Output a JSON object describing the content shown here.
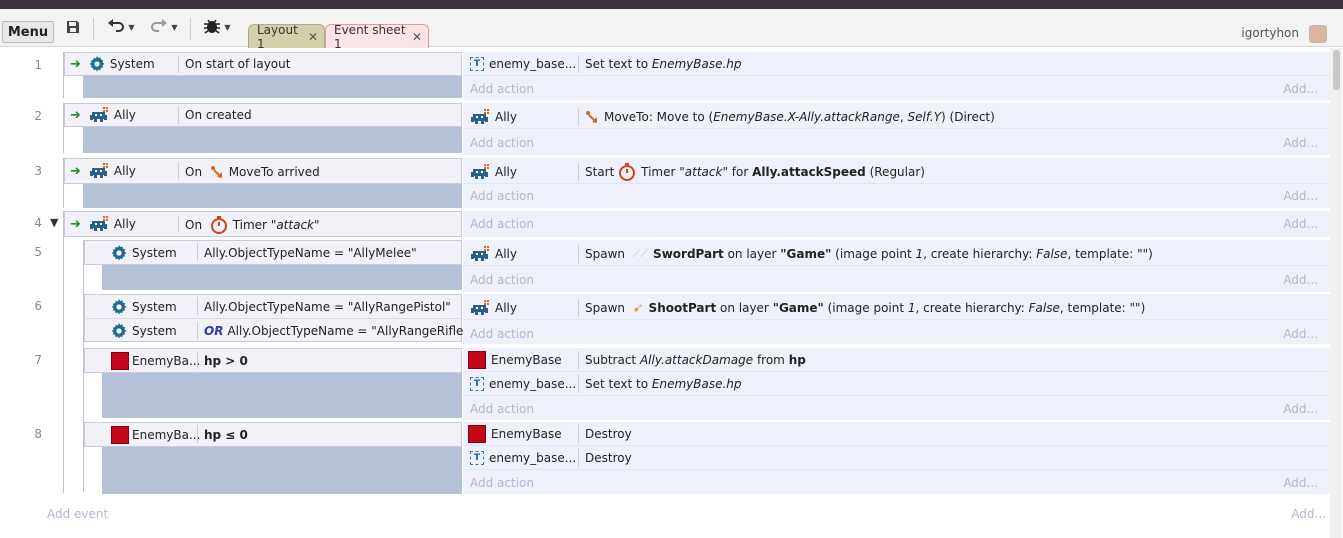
{
  "toolbar": {
    "menu_label": "Menu",
    "tabs": [
      {
        "label": "Layout 1"
      },
      {
        "label": "Event sheet 1"
      }
    ],
    "username": "igortyhon"
  },
  "sheet": {
    "add_action": "Add action",
    "add_dots": "Add...",
    "add_event": "Add event",
    "events": [
      {
        "num": "1",
        "object": "System",
        "condition": "On start of layout",
        "actions": [
          {
            "object": "enemy_base...",
            "text": "Set text to EnemyBase.hp"
          }
        ]
      },
      {
        "num": "2",
        "object": "Ally",
        "condition": "On created",
        "actions": [
          {
            "object": "Ally",
            "text": "MoveTo: Move to (EnemyBase.X-Ally.attackRange, Self.Y) (Direct)"
          }
        ]
      },
      {
        "num": "3",
        "object": "Ally",
        "condition": "On  MoveTo arrived",
        "actions": [
          {
            "object": "Ally",
            "text": "Start  Timer \"attack\" for Ally.attackSpeed (Regular)"
          }
        ]
      },
      {
        "num": "4",
        "object": "Ally",
        "condition": "On  Timer \"attack\"",
        "actions": []
      },
      {
        "num": "5",
        "object": "System",
        "condition": "Ally.ObjectTypeName = \"AllyMelee\"",
        "actions": [
          {
            "object": "Ally",
            "text": "Spawn  SwordPart on layer \"Game\" (image point 1, create hierarchy: False, template: \"\")"
          }
        ]
      },
      {
        "num": "6",
        "object": "System",
        "condition": "Ally.ObjectTypeName = \"AllyRangePistol\"",
        "object2": "System",
        "condition2_or": "OR",
        "condition2": "Ally.ObjectTypeName = \"AllyRangeRifle\"",
        "actions": [
          {
            "object": "Ally",
            "text": "Spawn  ShootPart on layer \"Game\" (image point 1, create hierarchy: False, template: \"\")"
          }
        ]
      },
      {
        "num": "7",
        "object": "EnemyBa...",
        "condition": "hp > 0",
        "actions": [
          {
            "object": "EnemyBase",
            "text": "Subtract Ally.attackDamage from hp"
          },
          {
            "object": "enemy_base...",
            "text": "Set text to EnemyBase.hp"
          }
        ]
      },
      {
        "num": "8",
        "object": "EnemyBa...",
        "condition": "hp ≤ 0",
        "actions": [
          {
            "object": "EnemyBase",
            "text": "Destroy"
          },
          {
            "object": "enemy_base...",
            "text": "Destroy"
          }
        ]
      }
    ]
  },
  "colors": {
    "accent": "#1c6ba0",
    "enemy_red": "#c4071a",
    "gap_blue": "#b4c1d6"
  }
}
